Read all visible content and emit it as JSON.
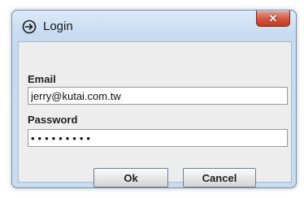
{
  "window": {
    "title": "Login",
    "title_icon": "arrow-circle-icon",
    "close_label": "✕"
  },
  "form": {
    "email_label": "Email",
    "email_value": "jerry@kutai.com.tw",
    "password_label": "Password",
    "password_value": "•••••••••"
  },
  "buttons": {
    "ok_label": "Ok",
    "cancel_label": "Cancel"
  },
  "colors": {
    "titlebar": "#c6dbf0",
    "close_button": "#c23a22",
    "client_background": "#ededed"
  }
}
